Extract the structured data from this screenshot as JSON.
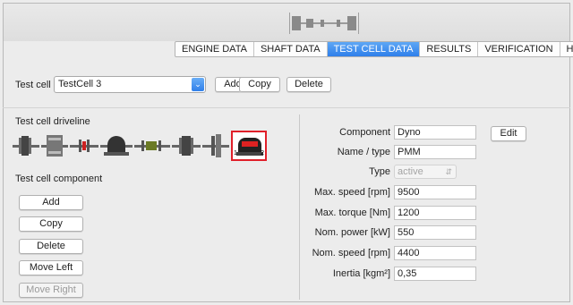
{
  "tabs": [
    {
      "label": "ENGINE DATA",
      "active": false
    },
    {
      "label": "SHAFT DATA",
      "active": false
    },
    {
      "label": "TEST CELL DATA",
      "active": true
    },
    {
      "label": "RESULTS",
      "active": false
    },
    {
      "label": "VERIFICATION",
      "active": false
    },
    {
      "label": "HELP",
      "active": false
    }
  ],
  "test_cell": {
    "label": "Test cell",
    "selected": "TestCell 3",
    "add_label": "Add",
    "copy_label": "Copy",
    "delete_label": "Delete"
  },
  "driveline": {
    "title": "Test cell driveline",
    "selected_marker_left": "1",
    "selected_marker_right": "2",
    "items": [
      "coupling-icon",
      "flywheel-icon",
      "shaft-icon",
      "gearbox-icon",
      "shaft-icon",
      "coupling-icon",
      "flywheel-icon",
      "dyno-icon"
    ]
  },
  "component_panel": {
    "title": "Test cell component",
    "add_label": "Add",
    "copy_label": "Copy",
    "delete_label": "Delete",
    "move_left_label": "Move Left",
    "move_right_label": "Move Right"
  },
  "properties": {
    "component_label": "Component",
    "component_value": "Dyno",
    "edit_label": "Edit",
    "name_label": "Name / type",
    "name_value": "PMM",
    "type_label": "Type",
    "type_value": "active",
    "max_speed_label": "Max. speed [rpm]",
    "max_speed_value": "9500",
    "max_torque_label": "Max. torque [Nm]",
    "max_torque_value": "1200",
    "nom_power_label": "Nom. power [kW]",
    "nom_power_value": "550",
    "nom_speed_label": "Nom. speed [rpm]",
    "nom_speed_value": "4400",
    "inertia_label": "Inertia [kgm²]",
    "inertia_value": "0,35"
  },
  "colors": {
    "accent": "#2f7fea",
    "selection": "#e0202a"
  }
}
